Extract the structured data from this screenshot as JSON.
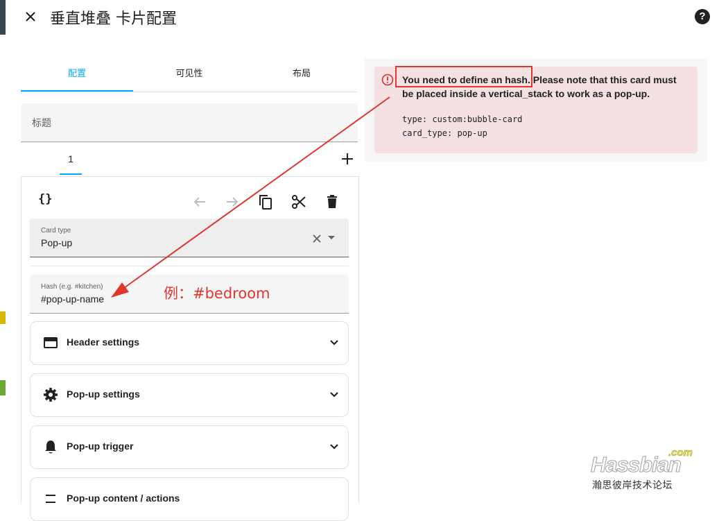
{
  "dialog": {
    "title": "垂直堆叠 卡片配置",
    "help_label": "?"
  },
  "tabs": [
    {
      "label": "配置",
      "active": true
    },
    {
      "label": "可见性",
      "active": false
    },
    {
      "label": "布局",
      "active": false
    }
  ],
  "title_field": {
    "placeholder": "标题"
  },
  "stack": {
    "tab_label": "1"
  },
  "editor": {
    "code_label": "{}",
    "card_type": {
      "label": "Card type",
      "value": "Pop-up"
    },
    "hash": {
      "label": "Hash (e.g. #kitchen)",
      "value": "#pop-up-name"
    },
    "sections": [
      {
        "label": "Header settings",
        "icon": "header-icon"
      },
      {
        "label": "Pop-up settings",
        "icon": "gear-icon"
      },
      {
        "label": "Pop-up trigger",
        "icon": "bell-icon"
      },
      {
        "label": "Pop-up content / actions",
        "icon": "sliders-icon"
      }
    ]
  },
  "preview": {
    "error_text": "You need to define an hash. Please note that this card must be placed inside a vertical_stack to work as a pop-up.",
    "code_line_1": "type: custom:bubble-card",
    "code_line_2": "card_type: pop-up"
  },
  "annotation": {
    "text": "例：#bedroom",
    "color": "#e0362c"
  },
  "watermark": {
    "logo": "Hassbian",
    "suffix": ".com",
    "subtitle": "瀚思彼岸技术论坛"
  },
  "colors": {
    "accent": "#03a9f4",
    "error_bg": "#f5e1e1",
    "annotation": "#e0362c"
  }
}
